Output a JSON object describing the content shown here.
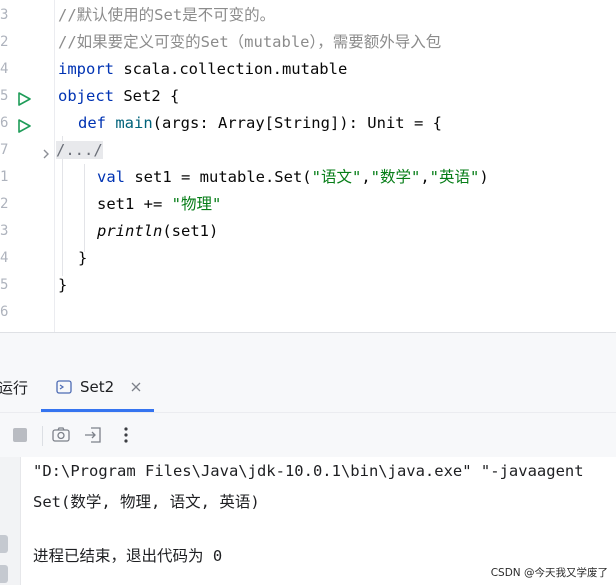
{
  "editor": {
    "lines": [
      {
        "num": "3",
        "segments": [
          {
            "t": "//默认使用的Set是不可变的。",
            "c": "cmt"
          }
        ]
      },
      {
        "num": "2",
        "segments": [
          {
            "t": "//如果要定义可变的Set（mutable），需要额外导入包",
            "c": "cmt"
          }
        ]
      },
      {
        "num": "4",
        "segments": [
          {
            "t": "import",
            "c": "kw"
          },
          {
            "t": " scala.collection.mutable",
            "c": ""
          }
        ]
      },
      {
        "num": "5",
        "segments": [
          {
            "t": "object",
            "c": "kw"
          },
          {
            "t": " Set2 {",
            "c": ""
          }
        ]
      },
      {
        "num": "6",
        "segments": [
          {
            "t": "def",
            "c": "kw"
          },
          {
            "t": " ",
            "c": ""
          },
          {
            "t": "main",
            "c": "fn"
          },
          {
            "t": "(args: Array[String]): Unit = {",
            "c": ""
          }
        ]
      },
      {
        "num": "7",
        "segments": [
          {
            "t": "/.../",
            "c": "fold"
          }
        ]
      },
      {
        "num": "1",
        "segments": [
          {
            "t": "val",
            "c": "kw"
          },
          {
            "t": " set1 = mutable.Set(",
            "c": ""
          },
          {
            "t": "\"语文\"",
            "c": "str"
          },
          {
            "t": ",",
            "c": ""
          },
          {
            "t": "\"数学\"",
            "c": "str"
          },
          {
            "t": ",",
            "c": ""
          },
          {
            "t": "\"英语\"",
            "c": "str"
          },
          {
            "t": ")",
            "c": ""
          }
        ]
      },
      {
        "num": "2",
        "segments": [
          {
            "t": "set1 += ",
            "c": ""
          },
          {
            "t": "\"物理\"",
            "c": "str"
          }
        ]
      },
      {
        "num": "3",
        "segments": [
          {
            "t": "println",
            "c": "it"
          },
          {
            "t": "(set1)",
            "c": ""
          }
        ]
      },
      {
        "num": "4",
        "segments": [
          {
            "t": "}",
            "c": ""
          }
        ]
      },
      {
        "num": "5",
        "segments": [
          {
            "t": "}",
            "c": ""
          }
        ]
      },
      {
        "num": "6",
        "segments": []
      }
    ]
  },
  "toolwindow": {
    "title": "运行",
    "tab_label": "Set2",
    "tab_close": "×"
  },
  "console": {
    "line1": "\"D:\\Program Files\\Java\\jdk-10.0.1\\bin\\java.exe\" \"-javaagent",
    "line2": "Set(数学, 物理, 语文, 英语)",
    "line3": "进程已结束，退出代码为 0"
  },
  "watermark": "CSDN @今天我又学废了",
  "colors": {
    "accent": "#3574f0",
    "run_green": "#1e9c58",
    "keyword": "#0033b3",
    "string": "#067d17",
    "comment": "#8c8c8c"
  }
}
